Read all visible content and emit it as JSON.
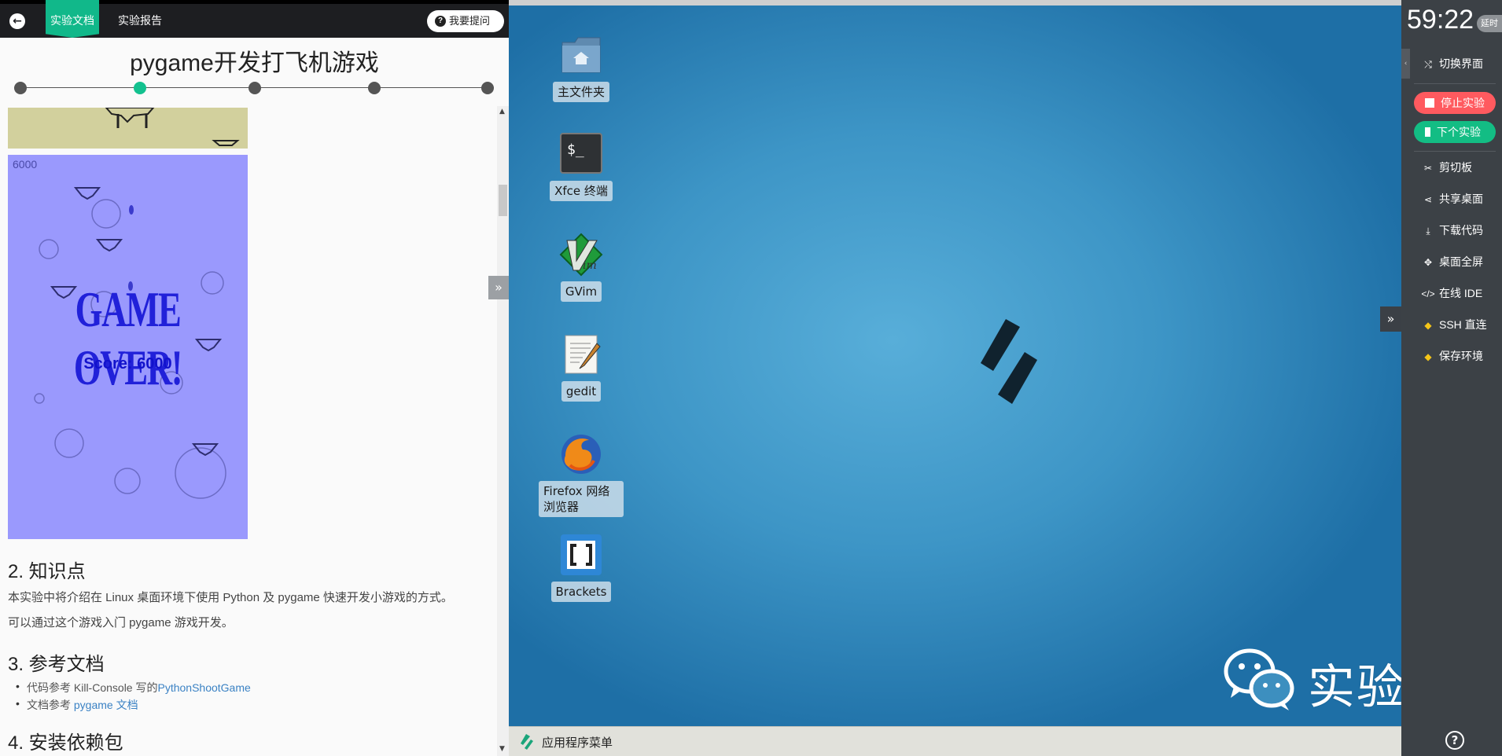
{
  "topbar": {
    "tabs": [
      "实验文档",
      "实验报告"
    ],
    "ask_label": "我要提问"
  },
  "doc": {
    "title": "pygame开发打飞机游戏",
    "steps": 5,
    "active_step": 2,
    "game": {
      "score_top": "6000",
      "game_over": "GAME OVER!",
      "score_label": "Score: 6000"
    },
    "sections": [
      {
        "heading": "2. 知识点",
        "paragraphs": [
          "本实验中将介绍在 Linux 桌面环境下使用 Python 及 pygame 快速开发小游戏的方式。",
          "可以通过这个游戏入门 pygame 游戏开发。"
        ]
      },
      {
        "heading": "3. 参考文档",
        "items": [
          {
            "prefix": "代码参考 Kill-Console 写的",
            "link": "PythonShootGame"
          },
          {
            "prefix": "文档参考 ",
            "link": "pygame 文档"
          }
        ]
      },
      {
        "heading": "4. 安装依赖包"
      }
    ]
  },
  "desktop": {
    "icons": [
      {
        "name": "home-folder",
        "label": "主文件夹"
      },
      {
        "name": "xfce-terminal",
        "label": "Xfce 终端"
      },
      {
        "name": "gvim",
        "label": "GVim"
      },
      {
        "name": "gedit",
        "label": "gedit"
      },
      {
        "name": "firefox",
        "label": "Firefox 网络浏览器"
      },
      {
        "name": "brackets",
        "label": "Brackets"
      }
    ],
    "watermark": "实验楼",
    "taskbar_label": "应用程序菜单",
    "colors": {
      "accent": "#13c18f",
      "stop": "#ff5a5f",
      "next": "#13bd84",
      "desktop": "#3d95c6"
    }
  },
  "sidebar": {
    "timer": "59:22",
    "extend_label": "延时",
    "switch_label": "切换界面",
    "stop_label": "停止实验",
    "next_label": "下个实验",
    "items": [
      {
        "icon": "scissors-icon",
        "label": "剪切板"
      },
      {
        "icon": "share-icon",
        "label": "共享桌面"
      },
      {
        "icon": "download-icon",
        "label": "下载代码"
      },
      {
        "icon": "fullscreen-icon",
        "label": "桌面全屏"
      },
      {
        "icon": "code-icon",
        "label": "在线 IDE"
      },
      {
        "icon": "diamond-icon",
        "label": "SSH 直连"
      },
      {
        "icon": "diamond-icon",
        "label": "保存环境"
      }
    ]
  }
}
